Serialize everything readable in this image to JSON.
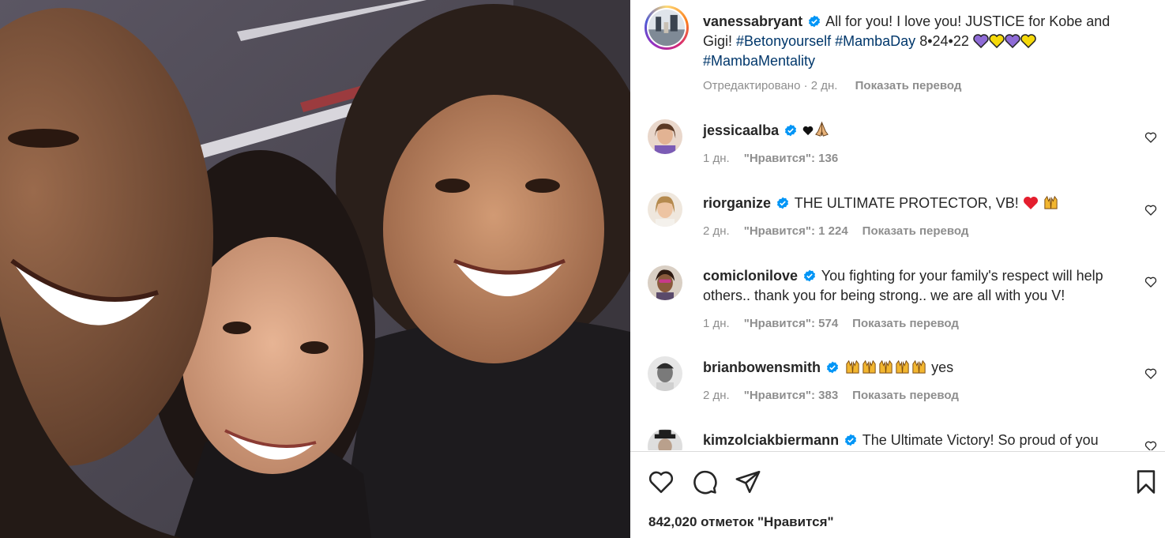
{
  "caption": {
    "username": "vanessabryant",
    "text_part1": "All for you! I love you! JUSTICE for Kobe and",
    "text_part2": "Gigi!",
    "hashtag1": "#Betonyourself",
    "hashtag2": "#MambaDay",
    "date_text": "8•24•22",
    "hashtag3": "#MambaMentality",
    "edited": "Отредактировано · 2 дн.",
    "show_translation": "Показать перевод"
  },
  "comments": [
    {
      "username": "jessicaalba",
      "text": "",
      "time": "1 дн.",
      "likes": "\"Нравится\": 136",
      "translate": ""
    },
    {
      "username": "riorganize",
      "text": "THE ULTIMATE PROTECTOR, VB!",
      "time": "2 дн.",
      "likes": "\"Нравится\": 1 224",
      "translate": "Показать перевод"
    },
    {
      "username": "comiclonilove",
      "text": "You fighting for your family's respect will help",
      "text2": "others.. thank you for being strong.. we are all with you V!",
      "time": "1 дн.",
      "likes": "\"Нравится\": 574",
      "translate": "Показать перевод"
    },
    {
      "username": "brianbowensmith",
      "text": "yes",
      "time": "2 дн.",
      "likes": "\"Нравится\": 383",
      "translate": "Показать перевод"
    },
    {
      "username": "kimzolciakbiermann",
      "text": "The Ultimate Victory! So proud of you",
      "time": "",
      "likes": "",
      "translate": ""
    }
  ],
  "likes_count": "842,020 отметок \"Нравится\"",
  "colors": {
    "verified": "#0095f6",
    "hashtag": "#00376b",
    "meta": "#8e8e8e",
    "heart_purple": "#8e6bd6",
    "heart_yellow": "#f5d90a",
    "heart_red": "#e41e2e"
  },
  "icons": [
    "like-icon",
    "comment-icon",
    "share-icon",
    "save-icon",
    "verified-icon"
  ]
}
